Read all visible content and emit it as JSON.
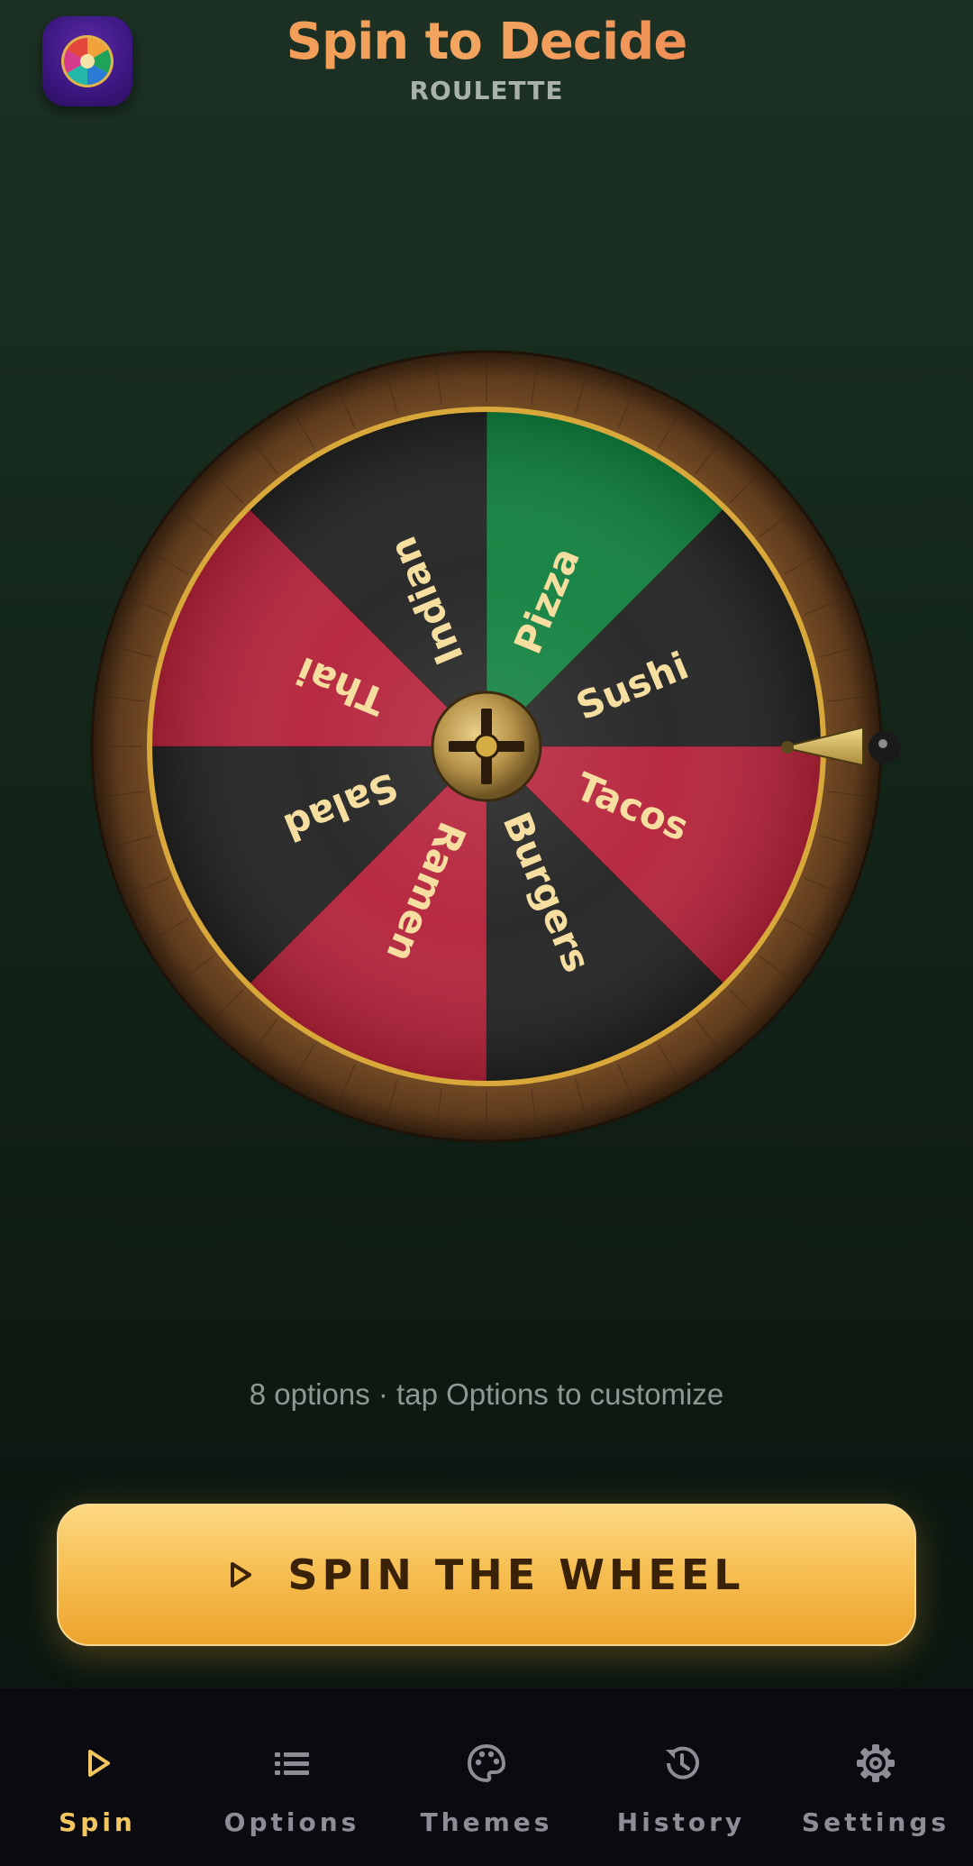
{
  "header": {
    "title": "Spin to Decide",
    "subtitle": "ROULETTE",
    "app_icon": "wheel-icon"
  },
  "wheel": {
    "segments": [
      {
        "label": "Pizza",
        "color": "#10803e"
      },
      {
        "label": "Sushi",
        "color": "#222222"
      },
      {
        "label": "Tacos",
        "color": "#b5223a"
      },
      {
        "label": "Burgers",
        "color": "#222222"
      },
      {
        "label": "Ramen",
        "color": "#b5223a"
      },
      {
        "label": "Salad",
        "color": "#222222"
      },
      {
        "label": "Thai",
        "color": "#b5223a"
      },
      {
        "label": "Indian",
        "color": "#222222"
      }
    ],
    "label_color": "#f6dea0",
    "rim_color": "#6b4525",
    "ring_color": "#d8a93a",
    "pointer": "pointer-icon",
    "hub": "hub-icon"
  },
  "status_text": "8 options · tap Options to customize",
  "spin_button": {
    "label": "SPIN THE WHEEL",
    "icon": "play-icon"
  },
  "nav": {
    "items": [
      {
        "label": "Spin",
        "icon": "play-icon",
        "active": true
      },
      {
        "label": "Options",
        "icon": "list-icon",
        "active": false
      },
      {
        "label": "Themes",
        "icon": "palette-icon",
        "active": false
      },
      {
        "label": "History",
        "icon": "history-icon",
        "active": false
      },
      {
        "label": "Settings",
        "icon": "gear-icon",
        "active": false
      }
    ],
    "active_color": "#f3c660",
    "inactive_color": "#8d8d96"
  }
}
